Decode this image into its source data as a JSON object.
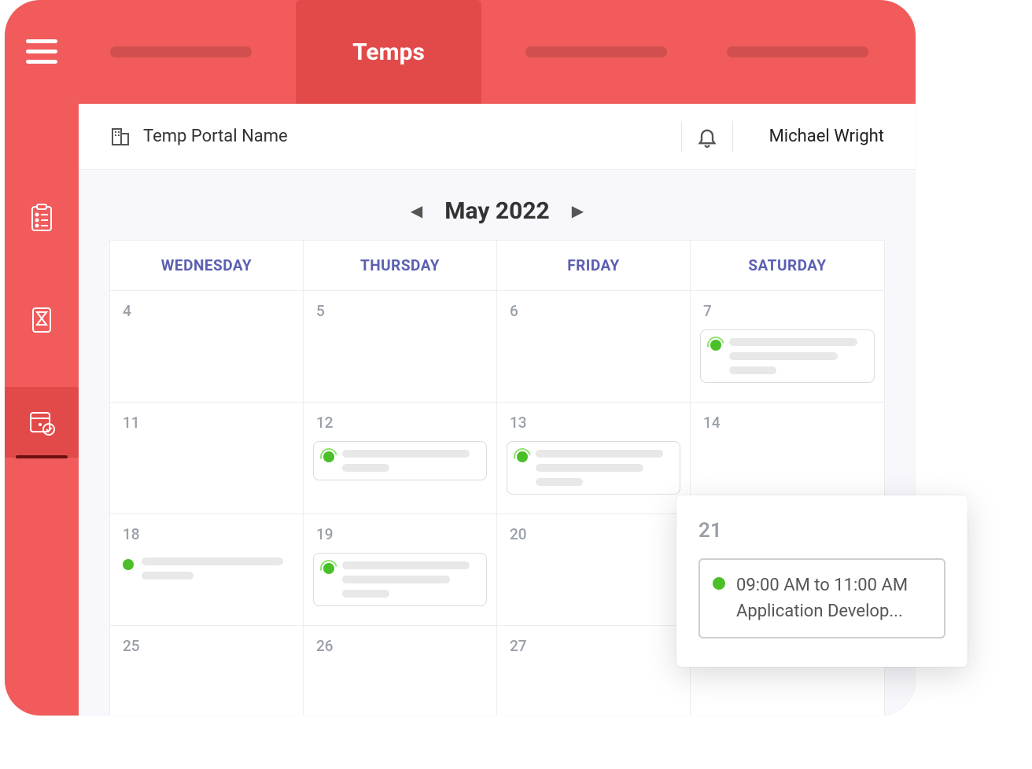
{
  "tabs": {
    "active_label": "Temps"
  },
  "header": {
    "portal_label": "Temp Portal Name",
    "user_name": "Michael Wright"
  },
  "calendar": {
    "month_label": "May 2022",
    "columns": [
      "WEDNESDAY",
      "THURSDAY",
      "FRIDAY",
      "SATURDAY"
    ],
    "rows": [
      [
        "4",
        "5",
        "6",
        "7"
      ],
      [
        "11",
        "12",
        "13",
        "14"
      ],
      [
        "18",
        "19",
        "20",
        "21"
      ],
      [
        "25",
        "26",
        "27",
        ""
      ]
    ]
  },
  "popup": {
    "day": "21",
    "time": "09:00 AM to 11:00 AM",
    "title": "Application Develop..."
  }
}
